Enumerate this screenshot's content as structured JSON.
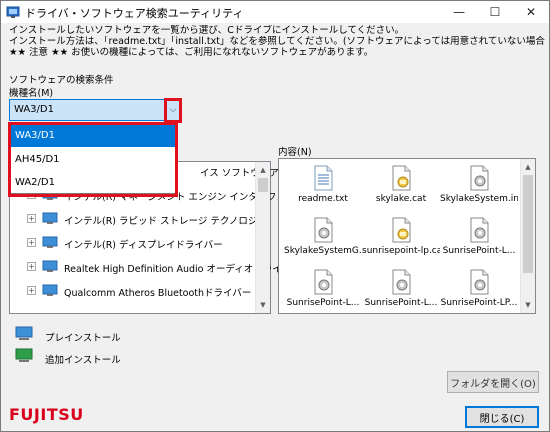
{
  "window": {
    "title": "ドライバ・ソフトウェア検索ユーティリティ",
    "controls": {
      "minimize": "—",
      "maximize": "☐",
      "close": "✕"
    }
  },
  "intro": {
    "line1": "インストールしたいソフトウェアを一覧から選び、Cドライブにインストールしてください。",
    "line2": "インストール方法は、「readme.txt」「install.txt」などを参照してください。(ソフトウェアによっては用意されていない場合もあります)",
    "line3": "★★ 注意 ★★ お使いの機種によっては、ご利用になれないソフトウェアがあります。"
  },
  "search": {
    "section_label": "ソフトウェアの検索条件",
    "model_label": "機種名(M)",
    "selected_model": "WA3/D1",
    "options": [
      "WA3/D1",
      "AH45/D1",
      "WA2/D1"
    ]
  },
  "tree": {
    "partial_top": "イス ソフトウェア",
    "items": [
      "インテル(R) マネージメント エンジン インターフェース",
      "インテル(R) ラピッド ストレージ テクノロジー",
      "インテル(R) ディスプレイドライバー",
      "Realtek High Definition Audio オーディオドライバー",
      "Qualcomm Atheros Bluetoothドライバー"
    ]
  },
  "content": {
    "label": "内容(N)",
    "files": [
      {
        "name": "readme.txt",
        "icon": "text-file-icon"
      },
      {
        "name": "skylake.cat",
        "icon": "catalog-file-icon"
      },
      {
        "name": "SkylakeSystem.inf",
        "icon": "inf-file-icon"
      },
      {
        "name": "SkylakeSystemG...",
        "icon": "inf-file-icon"
      },
      {
        "name": "sunrisepoint-lp.cat",
        "icon": "catalog-file-icon"
      },
      {
        "name": "SunrisePoint-L...",
        "icon": "inf-file-icon"
      },
      {
        "name": "SunrisePoint-L...",
        "icon": "inf-file-icon"
      },
      {
        "name": "SunrisePoint-L...",
        "icon": "inf-file-icon"
      },
      {
        "name": "SunrisePoint-LP...",
        "icon": "inf-file-icon"
      }
    ]
  },
  "legend": {
    "preinstall": "プレインストール",
    "additional": "追加インストール"
  },
  "buttons": {
    "open_folder": "フォルダを開く(O)",
    "close": "閉じる(C)"
  },
  "brand": {
    "logo": "FUJITSU"
  },
  "colors": {
    "accent": "#0078d7",
    "highlight_red": "#e0101e",
    "brand_red": "#d9001b"
  }
}
